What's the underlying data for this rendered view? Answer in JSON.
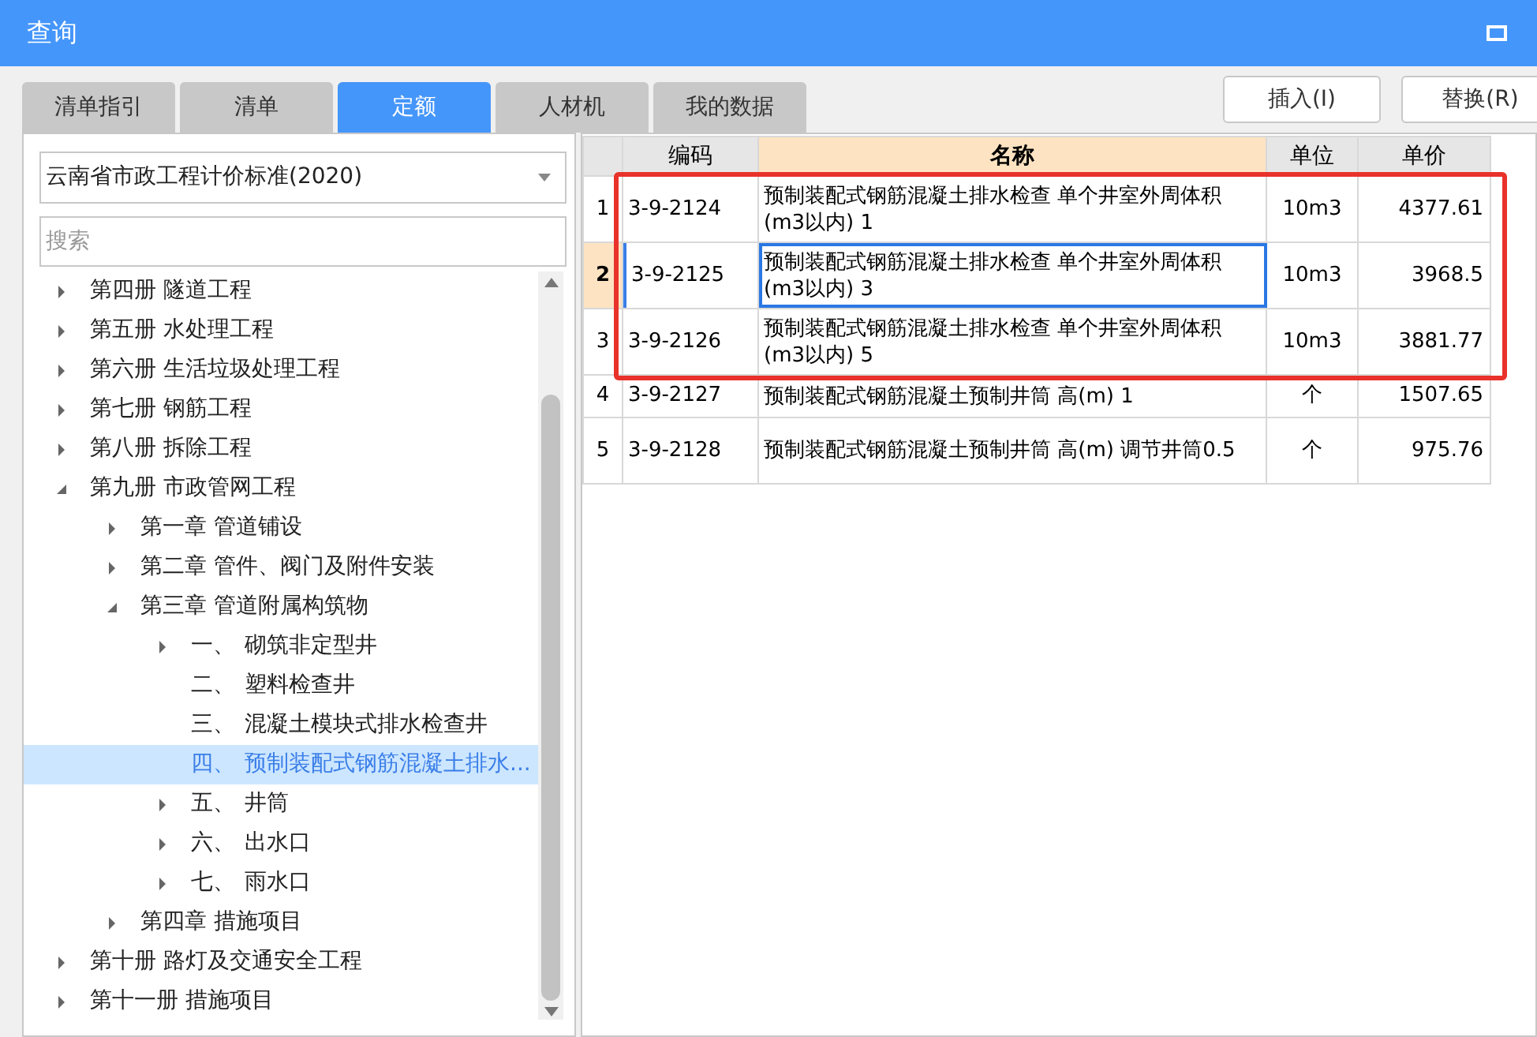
{
  "window": {
    "title": "查询"
  },
  "tabs": [
    {
      "label": "清单指引",
      "selected": false
    },
    {
      "label": "清单",
      "selected": false
    },
    {
      "label": "定额",
      "selected": true
    },
    {
      "label": "人材机",
      "selected": false
    },
    {
      "label": "我的数据",
      "selected": false
    }
  ],
  "buttons": [
    "插入(I)",
    "替换(R)"
  ],
  "standard_select": {
    "value": "云南省市政工程计价标准(2020)"
  },
  "search": {
    "placeholder": "搜索"
  },
  "tree": [
    {
      "label": "第四册 隧道工程",
      "kind": "branch",
      "expanded": false,
      "selected": false
    },
    {
      "label": "第五册 水处理工程",
      "kind": "branch",
      "expanded": false,
      "selected": false
    },
    {
      "label": "第六册 生活垃圾处理工程",
      "kind": "branch",
      "expanded": false,
      "selected": false
    },
    {
      "label": "第七册 钢筋工程",
      "kind": "branch",
      "expanded": false,
      "selected": false
    },
    {
      "label": "第八册 拆除工程",
      "kind": "branch",
      "expanded": false,
      "selected": false
    },
    {
      "label": "第九册 市政管网工程",
      "kind": "branch",
      "expanded": true,
      "selected": false,
      "children": [
        {
          "label": "第一章 管道铺设",
          "kind": "branch",
          "expanded": false,
          "selected": false
        },
        {
          "label": "第二章 管件、阀门及附件安装",
          "kind": "branch",
          "expanded": false,
          "selected": false
        },
        {
          "label": "第三章 管道附属构筑物",
          "kind": "branch",
          "expanded": true,
          "selected": false,
          "children": [
            {
              "number": "一、",
              "label": "砌筑非定型井",
              "kind": "branch",
              "expanded": false,
              "selected": false
            },
            {
              "number": "二、",
              "label": "塑料检查井",
              "kind": "leaf",
              "selected": false
            },
            {
              "number": "三、",
              "label": "混凝土模块式排水检查井",
              "kind": "leaf",
              "selected": false
            },
            {
              "number": "四、",
              "label": "预制装配式钢筋混凝土排水...",
              "kind": "leaf",
              "selected": true
            },
            {
              "number": "五、",
              "label": "井筒",
              "kind": "branch",
              "expanded": false,
              "selected": false
            },
            {
              "number": "六、",
              "label": "出水口",
              "kind": "branch",
              "expanded": false,
              "selected": false
            },
            {
              "number": "七、",
              "label": "雨水口",
              "kind": "branch",
              "expanded": false,
              "selected": false
            }
          ]
        },
        {
          "label": "第四章 措施项目",
          "kind": "branch",
          "expanded": false,
          "selected": false
        }
      ]
    },
    {
      "label": "第十册 路灯及交通安全工程",
      "kind": "branch",
      "expanded": false,
      "selected": false
    },
    {
      "label": "第十一册 措施项目",
      "kind": "branch",
      "expanded": false,
      "selected": false
    }
  ],
  "table": {
    "columns": [
      "编码",
      "名称",
      "单位",
      "单价"
    ],
    "rows": [
      {
        "index": "1",
        "code": "3-9-2124",
        "name": "预制装配式钢筋混凝土排水检查 单个井室外周体积(m3以内) 1",
        "unit": "10m3",
        "price": "4377.61",
        "selected": false,
        "highlighted": true
      },
      {
        "index": "2",
        "code": "3-9-2125",
        "name": "预制装配式钢筋混凝土排水检查 单个井室外周体积(m3以内) 3",
        "unit": "10m3",
        "price": "3968.5",
        "selected": true,
        "highlighted": true
      },
      {
        "index": "3",
        "code": "3-9-2126",
        "name": "预制装配式钢筋混凝土排水检查 单个井室外周体积(m3以内) 5",
        "unit": "10m3",
        "price": "3881.77",
        "selected": false,
        "highlighted": true
      },
      {
        "index": "4",
        "code": "3-9-2127",
        "name": "预制装配式钢筋混凝土预制井筒 高(m) 1",
        "unit": "个",
        "price": "1507.65",
        "selected": false,
        "highlighted": false
      },
      {
        "index": "5",
        "code": "3-9-2128",
        "name": "预制装配式钢筋混凝土预制井筒 高(m) 调节井筒0.5",
        "unit": "个",
        "price": "975.76",
        "selected": false,
        "highlighted": false
      }
    ]
  }
}
